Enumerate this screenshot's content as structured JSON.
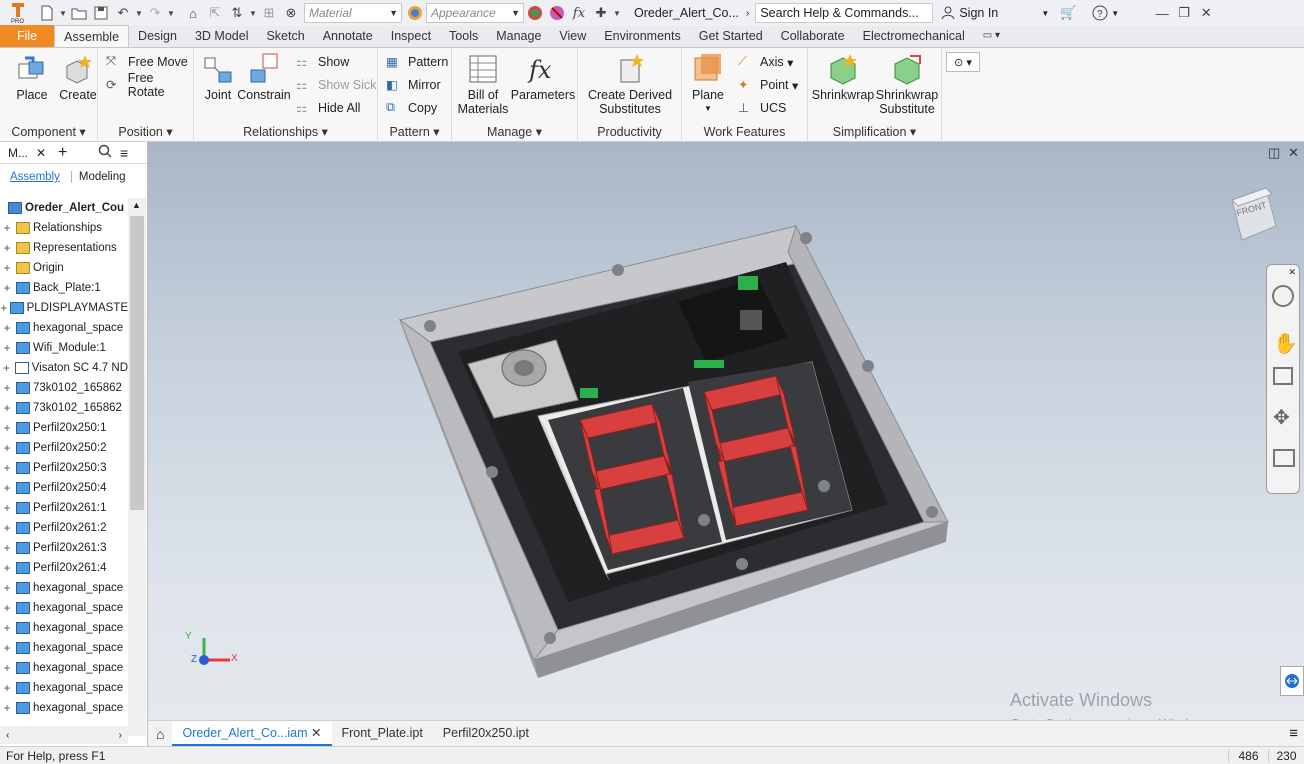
{
  "qat": {
    "material_placeholder": "Material",
    "appearance_placeholder": "Appearance",
    "doc_title": "Oreder_Alert_Co...",
    "search_placeholder": "Search Help & Commands...",
    "sign_in": "Sign In"
  },
  "tabs": [
    "File",
    "Assemble",
    "Design",
    "3D Model",
    "Sketch",
    "Annotate",
    "Inspect",
    "Tools",
    "Manage",
    "View",
    "Environments",
    "Get Started",
    "Collaborate",
    "Electromechanical"
  ],
  "ribbon": {
    "component": {
      "label": "Component",
      "place": "Place",
      "create": "Create"
    },
    "position": {
      "label": "Position",
      "free_move": "Free Move",
      "free_rotate": "Free Rotate"
    },
    "relationships": {
      "label": "Relationships",
      "joint": "Joint",
      "constrain": "Constrain",
      "show": "Show",
      "show_sick": "Show Sick",
      "hide_all": "Hide All"
    },
    "pattern": {
      "label": "Pattern",
      "pattern": "Pattern",
      "mirror": "Mirror",
      "copy": "Copy"
    },
    "manage": {
      "label": "Manage",
      "bom_line1": "Bill of",
      "bom_line2": "Materials",
      "parameters": "Parameters"
    },
    "productivity": {
      "label": "Productivity",
      "cds_line1": "Create Derived",
      "cds_line2": "Substitutes"
    },
    "work_features": {
      "label": "Work Features",
      "plane": "Plane",
      "axis": "Axis",
      "point": "Point",
      "ucs": "UCS"
    },
    "simplification": {
      "label": "Simplification",
      "shrinkwrap": "Shrinkwrap",
      "sws_line1": "Shrinkwrap",
      "sws_line2": "Substitute"
    }
  },
  "browser": {
    "title": "M...",
    "tab_assembly": "Assembly",
    "tab_modeling": "Modeling",
    "root": "Oreder_Alert_Cou",
    "items": [
      {
        "label": "Relationships",
        "icon": "folder"
      },
      {
        "label": "Representations",
        "icon": "representations"
      },
      {
        "label": "Origin",
        "icon": "folder"
      },
      {
        "label": "Back_Plate:1",
        "icon": "part"
      },
      {
        "label": "PLDISPLAYMASTE",
        "icon": "assembly"
      },
      {
        "label": "hexagonal_space",
        "icon": "part"
      },
      {
        "label": "Wifi_Module:1",
        "icon": "assembly"
      },
      {
        "label": "Visaton SC 4.7 ND",
        "icon": "part-outline"
      },
      {
        "label": "73k0102_165862",
        "icon": "part"
      },
      {
        "label": "73k0102_165862",
        "icon": "part"
      },
      {
        "label": "Perfil20x250:1",
        "icon": "part"
      },
      {
        "label": "Perfil20x250:2",
        "icon": "part"
      },
      {
        "label": "Perfil20x250:3",
        "icon": "part"
      },
      {
        "label": "Perfil20x250:4",
        "icon": "part"
      },
      {
        "label": "Perfil20x261:1",
        "icon": "part"
      },
      {
        "label": "Perfil20x261:2",
        "icon": "part"
      },
      {
        "label": "Perfil20x261:3",
        "icon": "part"
      },
      {
        "label": "Perfil20x261:4",
        "icon": "part"
      },
      {
        "label": "hexagonal_space",
        "icon": "part"
      },
      {
        "label": "hexagonal_space",
        "icon": "part"
      },
      {
        "label": "hexagonal_space",
        "icon": "part"
      },
      {
        "label": "hexagonal_space",
        "icon": "part"
      },
      {
        "label": "hexagonal_space",
        "icon": "part"
      },
      {
        "label": "hexagonal_space",
        "icon": "part"
      },
      {
        "label": "hexagonal_space",
        "icon": "part"
      }
    ]
  },
  "viewcube_label": "FRONT",
  "doc_tabs": [
    "Oreder_Alert_Co...iam",
    "Front_Plate.ipt",
    "Perfil20x250.ipt"
  ],
  "status": {
    "help": "For Help, press F1",
    "num1": "486",
    "num2": "230"
  },
  "watermark": {
    "line1": "Activate Windows",
    "line2": "Go to Settings to activate Windows."
  },
  "triad": {
    "x": "X",
    "y": "Y",
    "z": "Z"
  }
}
